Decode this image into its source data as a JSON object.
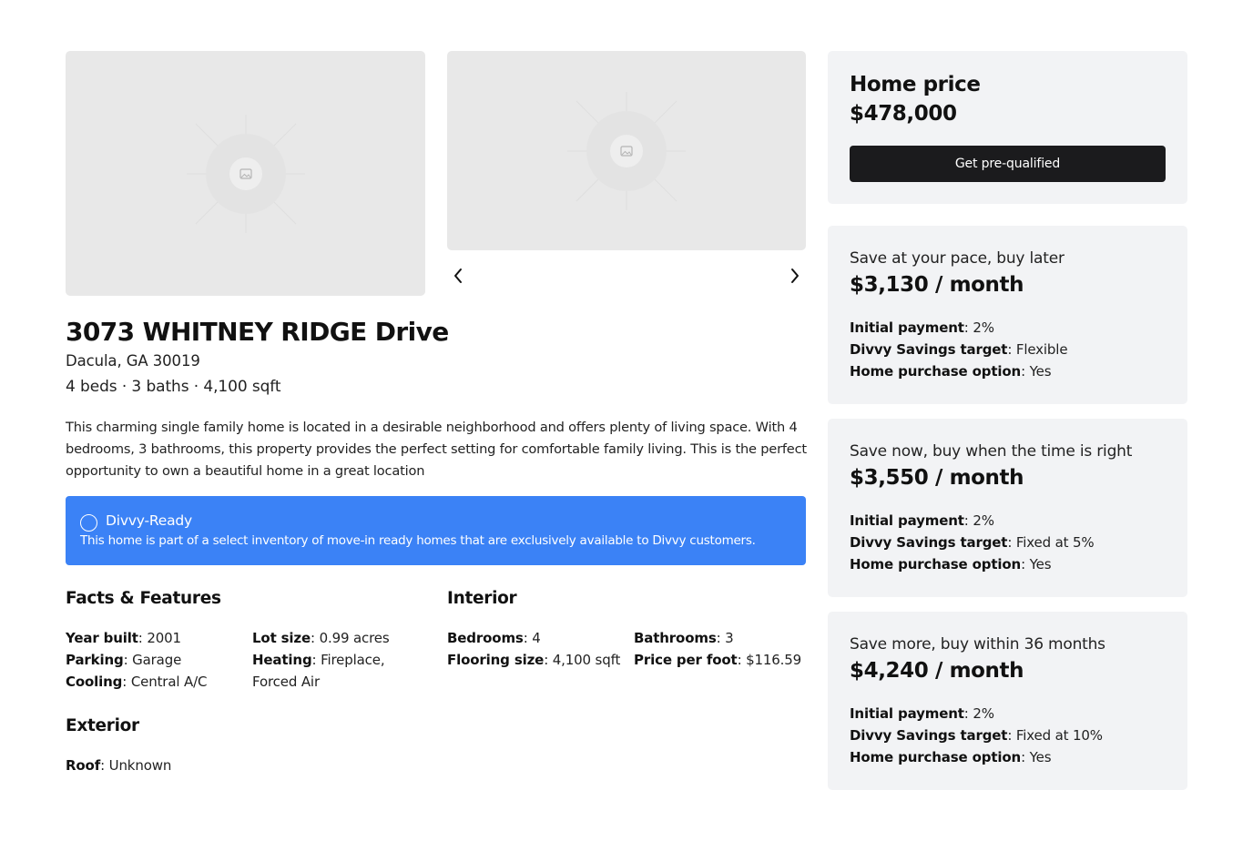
{
  "gallery": {
    "prev_label": "Previous photo",
    "next_label": "Next photo"
  },
  "listing": {
    "address": "3073 WHITNEY RIDGE Drive",
    "city": "Dacula, GA 30019",
    "specs": "4 beds · 3 baths · 4,100 sqft",
    "description": "This charming single family home is located in a desirable neighborhood and offers plenty of living space. With 4 bedrooms, 3 bathrooms, this property provides the perfect setting for comfortable family living. This is the perfect opportunity to own a beautiful home in a great location"
  },
  "banner": {
    "title": "Divvy-Ready",
    "text": "This home is part of a select inventory of move-in ready homes that are exclusively available to Divvy customers.",
    "color": "#3b82f6"
  },
  "facts": {
    "heading": "Facts & Features",
    "col1": [
      {
        "label": "Year built",
        "value": "2001"
      },
      {
        "label": "Parking",
        "value": "Garage"
      },
      {
        "label": "Cooling",
        "value": "Central A/C"
      }
    ],
    "col2": [
      {
        "label": "Lot size",
        "value": "0.99 acres"
      },
      {
        "label": "Heating",
        "value": "Fireplace, Forced Air"
      }
    ]
  },
  "interior": {
    "heading": "Interior",
    "col1": [
      {
        "label": "Bedrooms",
        "value": "4"
      },
      {
        "label": "Flooring size",
        "value": "4,100 sqft"
      }
    ],
    "col2": [
      {
        "label": "Bathrooms",
        "value": "3"
      },
      {
        "label": "Price per foot",
        "value": "$116.59"
      }
    ]
  },
  "exterior": {
    "heading": "Exterior",
    "items": [
      {
        "label": "Roof",
        "value": "Unknown"
      }
    ]
  },
  "pricing": {
    "label": "Home price",
    "value": "$478,000",
    "cta": "Get pre-qualified"
  },
  "plans": [
    {
      "title": "Save at your pace, buy later",
      "amount": "$3,130 / month",
      "details": [
        {
          "label": "Initial payment",
          "value": "2%"
        },
        {
          "label": "Divvy Savings target",
          "value": "Flexible"
        },
        {
          "label": "Home purchase option",
          "value": "Yes"
        }
      ]
    },
    {
      "title": "Save now, buy when the time is right",
      "amount": "$3,550 / month",
      "details": [
        {
          "label": "Initial payment",
          "value": "2%"
        },
        {
          "label": "Divvy Savings target",
          "value": "Fixed at 5%"
        },
        {
          "label": "Home purchase option",
          "value": "Yes"
        }
      ]
    },
    {
      "title": "Save more, buy within 36 months",
      "amount": "$4,240 / month",
      "details": [
        {
          "label": "Initial payment",
          "value": "2%"
        },
        {
          "label": "Divvy Savings target",
          "value": "Fixed at 10%"
        },
        {
          "label": "Home purchase option",
          "value": "Yes"
        }
      ]
    }
  ]
}
